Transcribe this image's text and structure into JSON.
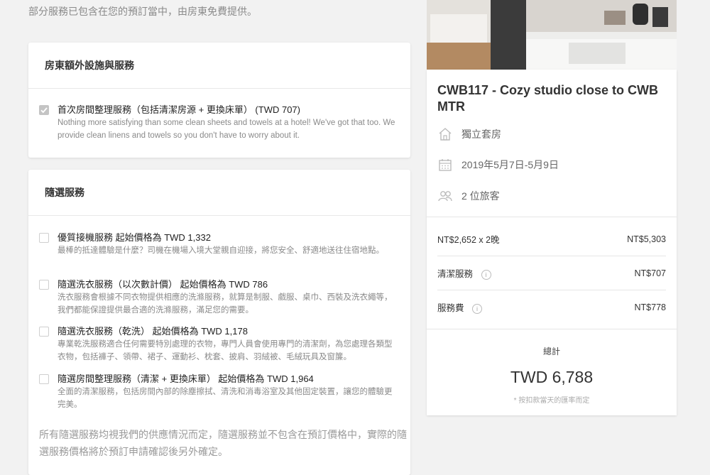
{
  "intro": "部分服務已包含在您的預訂當中，由房東免費提供。",
  "host_services": {
    "heading": "房東額外設施與服務",
    "items": [
      {
        "checked": true,
        "title": "首次房間整理服務（包括清潔房源 + 更換床單） (TWD 707)",
        "desc": "Nothing more satisfying than some clean sheets and towels at a hotel! We've got that too. We provide clean linens and towels so you don't have to worry about it."
      }
    ]
  },
  "optional_services": {
    "heading": "隨選服務",
    "items": [
      {
        "checked": false,
        "title": "優質接機服務 起始價格為 TWD 1,332",
        "desc": "最棒的抵達體驗是什麼？司機在機場入境大堂親自迎接，將您安全、舒適地送往住宿地點。"
      },
      {
        "checked": false,
        "title": "隨選洗衣服務（以次數計價） 起始價格為 TWD 786",
        "desc": "洗衣服務會根據不同衣物提供相應的洗滌服務，就算是制服、戲服、桌巾、西裝及洗衣繩等，我們都能保證提供最合適的洗滌服務，滿足您的需要。"
      },
      {
        "checked": false,
        "title": "隨選洗衣服務（乾洗） 起始價格為 TWD 1,178",
        "desc": "專業乾洗服務適合任何需要特別處理的衣物，專門人員會使用專門的清潔劑，為您處理各類型衣物，包括褲子、領帶、裙子、運動衫、枕套、披肩、羽絨被、毛絨玩具及窗簾。"
      },
      {
        "checked": false,
        "title": "隨選房間整理服務（清潔 + 更換床單） 起始價格為 TWD 1,964",
        "desc": "全面的清潔服務，包括房間內部的除塵擦拭、清洗和消毒浴室及其他固定裝置，讓您的體驗更完美。"
      }
    ]
  },
  "note": "所有隨選服務均視我們的供應情況而定，隨選服務並不包含在預訂價格中，實際的隨選服務價格將於預訂申請確認後另外確定。",
  "summary": {
    "title": "CWB117 - Cozy studio close to CWB MTR",
    "room_type": "獨立套房",
    "dates": "2019年5月7日-5月9日",
    "guests": "2 位旅客",
    "lines": [
      {
        "label": "NT$2,652 x 2晚",
        "value": "NT$5,303",
        "info": false
      },
      {
        "label": "清潔服務",
        "value": "NT$707",
        "info": true
      },
      {
        "label": "服務費",
        "value": "NT$778",
        "info": true
      }
    ],
    "total_label": "總計",
    "total_value": "TWD 6,788",
    "total_note": "* 按扣款當天的匯率而定"
  },
  "icons": {
    "info": "i"
  }
}
